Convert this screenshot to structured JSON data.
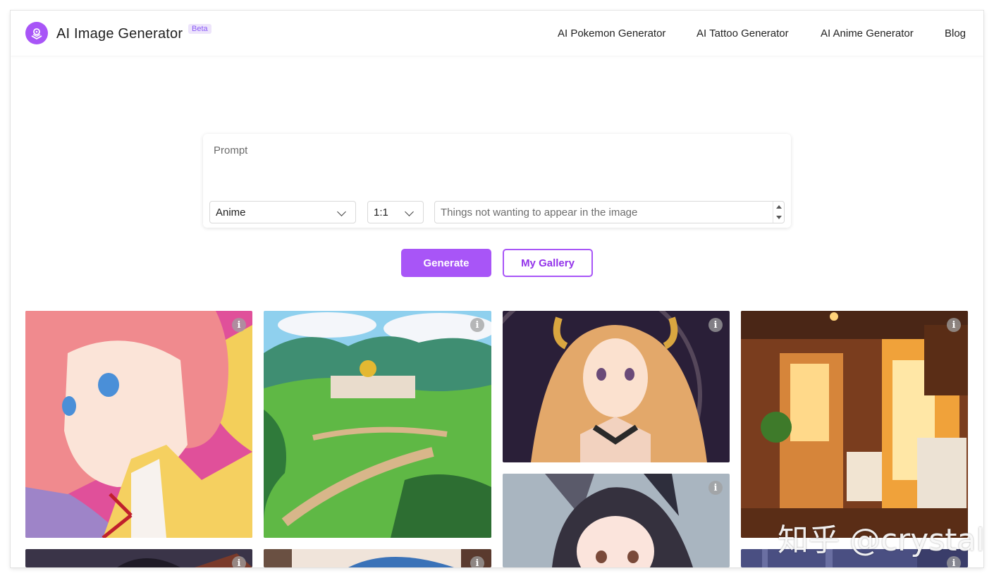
{
  "header": {
    "brand": "AI Image Generator",
    "badge": "Beta",
    "nav": [
      "AI Pokemon Generator",
      "AI Tattoo Generator",
      "AI Anime Generator",
      "Blog"
    ]
  },
  "form": {
    "prompt_placeholder": "Prompt",
    "style_value": "Anime",
    "ratio_value": "1:1",
    "negative_placeholder": "Things not wanting to appear in the image"
  },
  "buttons": {
    "generate": "Generate",
    "gallery": "My Gallery"
  },
  "gallery": {
    "info_glyph": "i",
    "tiles": [
      "pink-haired anime girl",
      "anime landscape with castle",
      "blonde anime girl with horns",
      "warm bathroom interior",
      "black-haired cat-eared anime girl",
      "dark anime portrait",
      "blue-haired anime character",
      "purple interior"
    ]
  },
  "watermark": "知乎 @crystal",
  "colors": {
    "accent": "#a855f7",
    "beta_bg": "#ede4fb"
  }
}
